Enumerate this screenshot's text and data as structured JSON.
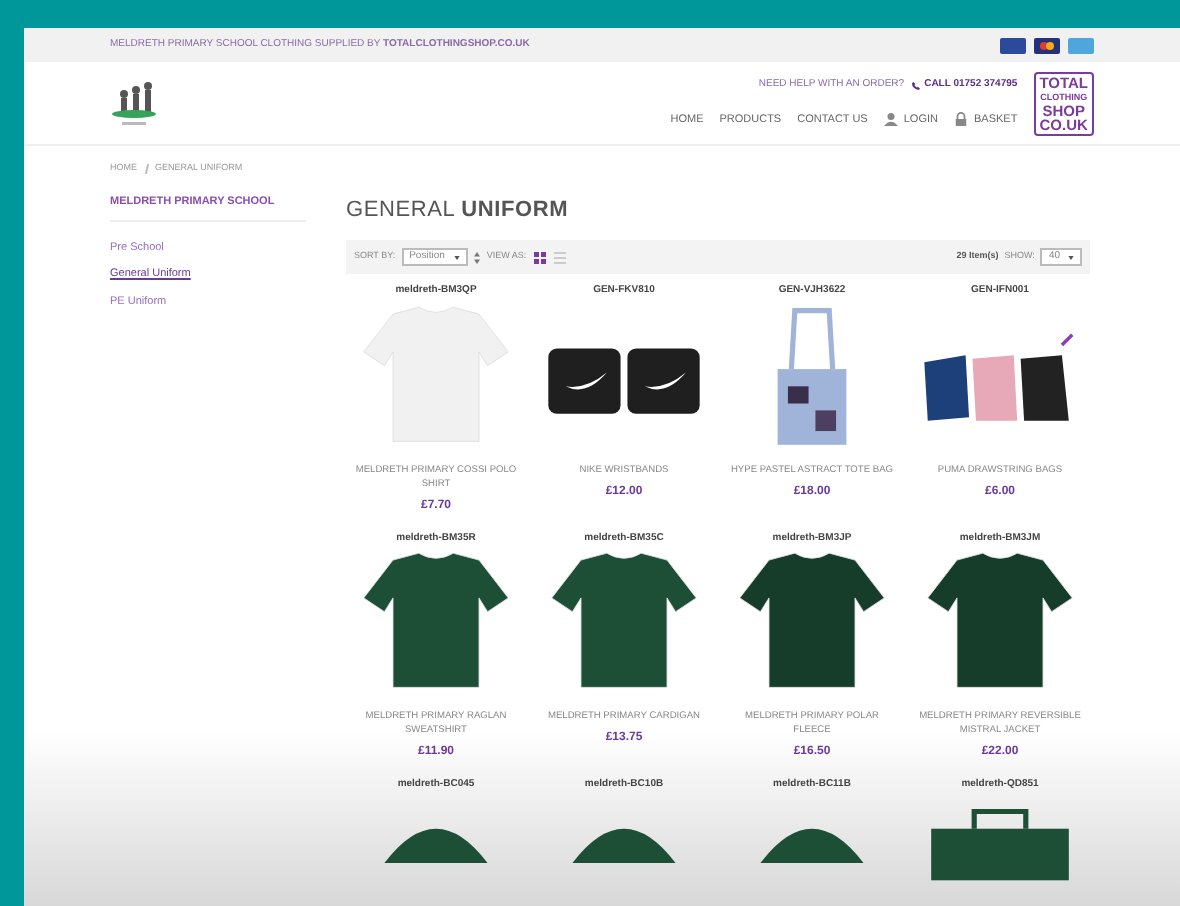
{
  "top_bar": {
    "notice": "MELDRETH PRIMARY SCHOOL CLOTHING SUPPLIED BY **TOTALCLOTHINGSHOP.CO.UK**"
  },
  "header": {
    "help": "NEED HELP WITH AN ORDER?",
    "phone": "CALL 01752 374795",
    "nav": [
      "HOME",
      "PRODUCTS",
      "CONTACT US"
    ],
    "login": "LOGIN",
    "basket": "BASKET",
    "brand_logo": [
      "TOTAL",
      "CLOTHING",
      "SHOP",
      "CO.UK"
    ]
  },
  "breadcrumb": [
    "HOME",
    "GENERAL UNIFORM"
  ],
  "sidebar": {
    "title": "MELDRETH PRIMARY SCHOOL",
    "items": [
      {
        "label": "Pre School",
        "selected": false
      },
      {
        "label": "General Uniform",
        "selected": true
      },
      {
        "label": "PE Uniform",
        "selected": false
      }
    ]
  },
  "main": {
    "title_light": "GENERAL",
    "title_bold": "UNIFORM",
    "toolbar": {
      "sort_label": "SORT BY:",
      "sort_value": "Position",
      "view_label": "VIEW AS:",
      "view_modes": [
        {
          "kind": "grid",
          "selected": true
        },
        {
          "kind": "list",
          "selected": false
        }
      ],
      "count": "29 Item(s)",
      "show_label": "SHOW:",
      "show_value": "40"
    },
    "products": [
      {
        "sku": "meldreth-BM3QP",
        "kind": "shirt",
        "name": "MELDRETH PRIMARY COSSI POLO SHIRT",
        "price": "£7.70"
      },
      {
        "sku": "GEN-FKV810",
        "kind": "wristbands",
        "name": "NIKE WRISTBANDS",
        "price": "£12.00"
      },
      {
        "sku": "GEN-VJH3622",
        "kind": "tote",
        "name": "HYPE PASTEL ASTRACT TOTE BAG",
        "price": "£18.00"
      },
      {
        "sku": "GEN-IFN001",
        "kind": "bags",
        "name": "PUMA DRAWSTRING BAGS",
        "price": "£6.00"
      },
      {
        "sku": "meldreth-BM35R",
        "kind": "shirt",
        "name": "MELDRETH PRIMARY RAGLAN SWEATSHIRT",
        "price": "£11.90"
      },
      {
        "sku": "meldreth-BM35C",
        "kind": "shirt",
        "name": "MELDRETH PRIMARY CARDIGAN",
        "price": "£13.75"
      },
      {
        "sku": "meldreth-BM3JP",
        "kind": "shirt",
        "name": "MELDRETH PRIMARY POLAR FLEECE",
        "price": "£16.50"
      },
      {
        "sku": "meldreth-BM3JM",
        "kind": "shirt",
        "name": "MELDRETH PRIMARY REVERSIBLE MISTRAL JACKET",
        "price": "£22.00"
      },
      {
        "sku": "meldreth-BC045",
        "kind": "cap"
      },
      {
        "sku": "meldreth-BC10B",
        "kind": "cap"
      },
      {
        "sku": "meldreth-BC11B",
        "kind": "cap"
      },
      {
        "sku": "meldreth-QD851",
        "kind": "bag"
      }
    ]
  }
}
